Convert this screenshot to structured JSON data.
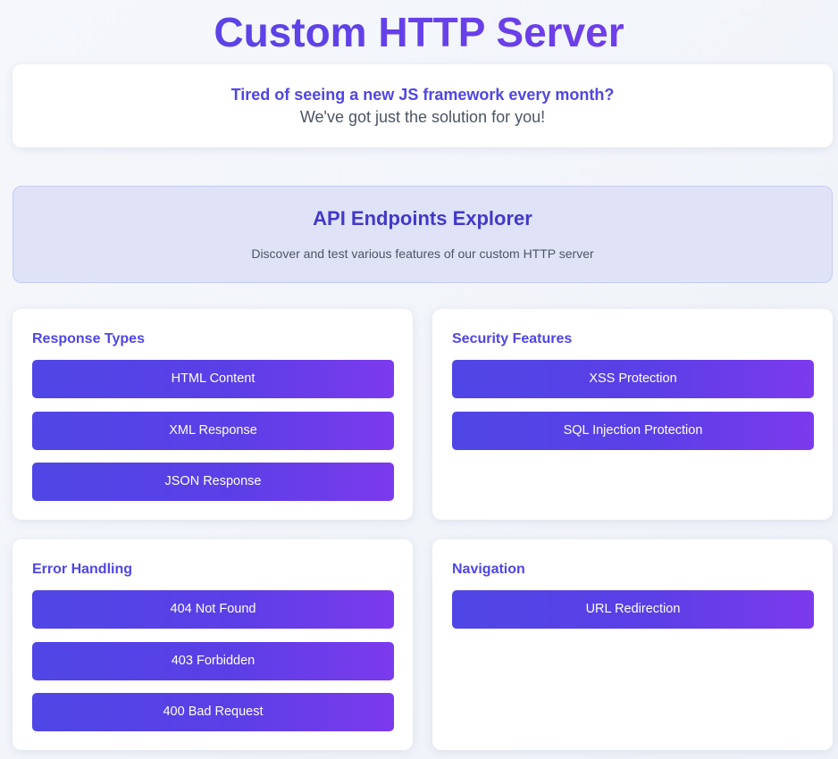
{
  "header": {
    "title": "Custom HTTP Server"
  },
  "tagline": {
    "question": "Tired of seeing a new JS framework every month?",
    "answer": "We've got just the solution for you!"
  },
  "explorer": {
    "title": "API Endpoints Explorer",
    "subtitle": "Discover and test various features of our custom HTTP server"
  },
  "sections": {
    "response_types": {
      "title": "Response Types",
      "buttons": [
        "HTML Content",
        "XML Response",
        "JSON Response"
      ]
    },
    "security_features": {
      "title": "Security Features",
      "buttons": [
        "XSS Protection",
        "SQL Injection Protection"
      ]
    },
    "error_handling": {
      "title": "Error Handling",
      "buttons": [
        "404 Not Found",
        "403 Forbidden",
        "400 Bad Request"
      ]
    },
    "navigation": {
      "title": "Navigation",
      "buttons": [
        "URL Redirection"
      ]
    }
  },
  "colors": {
    "accent": "#4f46e5",
    "accent_end": "#7c3aed",
    "banner_bg": "#e0e3f8"
  }
}
